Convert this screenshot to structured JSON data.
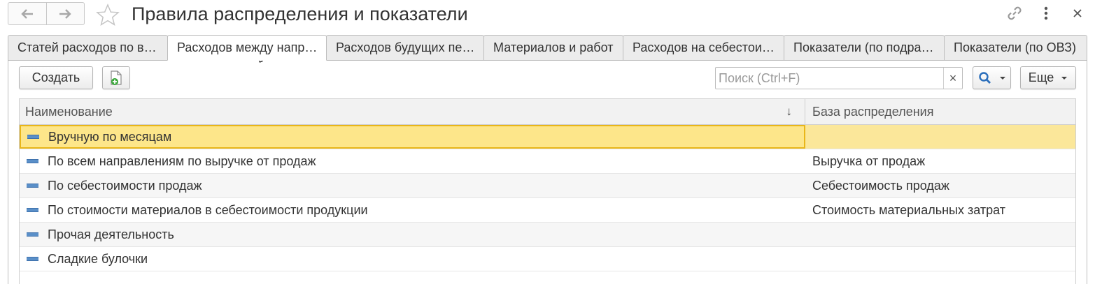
{
  "header": {
    "title": "Правила распределения и показатели"
  },
  "tabs": [
    {
      "label": "Статей расходов по в…"
    },
    {
      "label": "Расходов между напр…"
    },
    {
      "label": "Расходов будущих пе…"
    },
    {
      "label": "Материалов и работ"
    },
    {
      "label": "Расходов на себестои…"
    },
    {
      "label": "Показатели (по подра…"
    },
    {
      "label": "Показатели (по ОВЗ)"
    }
  ],
  "active_tab": 1,
  "toolbar": {
    "create_label": "Создать",
    "more_label": "Еще",
    "search_placeholder": "Поиск (Ctrl+F)",
    "search_clear": "×"
  },
  "table": {
    "columns": [
      "Наименование",
      "База распределения"
    ],
    "sort_indicator": "↓",
    "rows": [
      {
        "name": "Вручную по месяцам",
        "base": ""
      },
      {
        "name": "По всем направлениям по выручке от продаж",
        "base": "Выручка от продаж"
      },
      {
        "name": "По себестоимости продаж",
        "base": "Себестоимость продаж"
      },
      {
        "name": "По стоимости материалов в себестоимости продукции",
        "base": "Стоимость материальных затрат"
      },
      {
        "name": "Прочая деятельность",
        "base": ""
      },
      {
        "name": "Сладкие булочки",
        "base": ""
      }
    ],
    "selected_row": 0
  },
  "colors": {
    "selection_fill": "#fde68a",
    "selection_border": "#e9b619",
    "row_icon": "#5a8fc8",
    "search_icon": "#2a6ebb"
  },
  "icons": [
    "back-arrow-icon",
    "forward-arrow-icon",
    "star-icon",
    "link-icon",
    "more-vert-icon",
    "close-icon",
    "add-document-icon",
    "search-icon",
    "dropdown-arrow-icon",
    "sort-down-icon",
    "row-item-icon"
  ]
}
